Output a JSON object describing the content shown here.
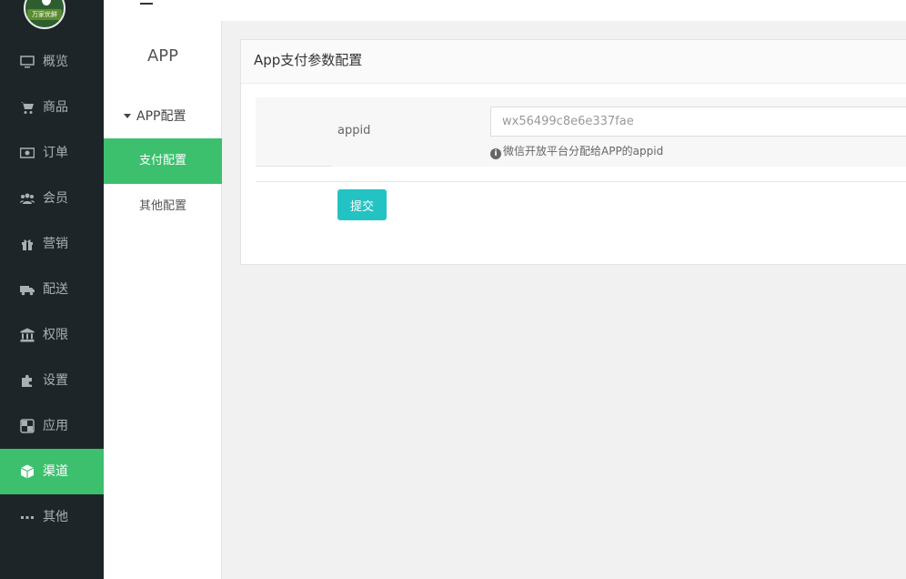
{
  "brand": {
    "logo_text": "万家优鲜"
  },
  "nav": {
    "items": [
      {
        "label": "概览",
        "icon": "monitor-icon"
      },
      {
        "label": "商品",
        "icon": "cart-icon"
      },
      {
        "label": "订单",
        "icon": "money-icon"
      },
      {
        "label": "会员",
        "icon": "users-icon"
      },
      {
        "label": "营销",
        "icon": "gift-icon"
      },
      {
        "label": "配送",
        "icon": "truck-icon"
      },
      {
        "label": "权限",
        "icon": "bank-icon"
      },
      {
        "label": "设置",
        "icon": "puzzle-icon"
      },
      {
        "label": "应用",
        "icon": "apps-icon"
      },
      {
        "label": "渠道",
        "icon": "cube-icon",
        "active": true
      },
      {
        "label": "其他",
        "icon": "more-icon"
      }
    ]
  },
  "subnav": {
    "title": "APP",
    "group_label": "APP配置",
    "items": [
      {
        "label": "支付配置",
        "active": true
      },
      {
        "label": "其他配置"
      }
    ]
  },
  "panel": {
    "title": "App支付参数配置",
    "field_label": "appid",
    "field_value": "wx56499c8e6e337fae",
    "help_text": "微信开放平台分配给APP的appid",
    "submit_label": "提交"
  },
  "colors": {
    "accent": "#3cc06e",
    "submit": "#23c3c3",
    "nav_bg": "#1e2528"
  }
}
